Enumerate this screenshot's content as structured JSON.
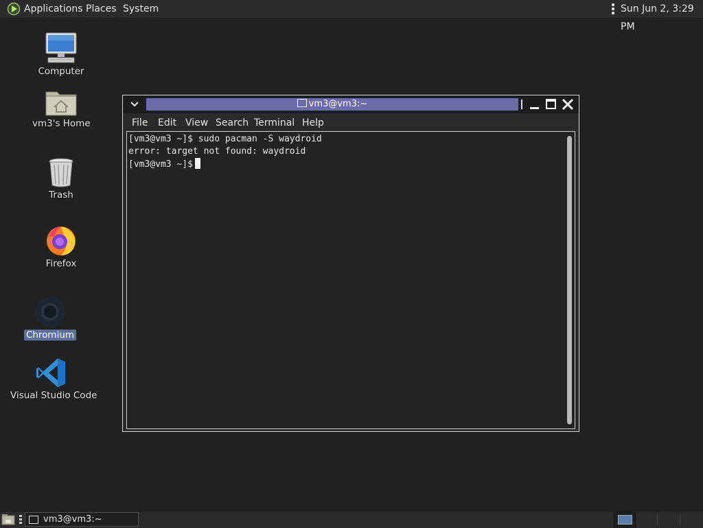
{
  "top_panel": {
    "menus": [
      "Applications",
      "Places",
      "System"
    ],
    "clock": "Sun Jun  2,  3:29 PM"
  },
  "desktop": {
    "icons": [
      {
        "label": "Computer",
        "icon": "computer-icon"
      },
      {
        "label": "vm3's Home",
        "icon": "home-folder-icon"
      },
      {
        "label": "Trash",
        "icon": "trash-icon"
      },
      {
        "label": "Firefox",
        "icon": "firefox-icon"
      },
      {
        "label": "Chromium",
        "icon": "chromium-icon",
        "selected": true
      },
      {
        "label": "Visual Studio Code",
        "icon": "vscode-icon"
      }
    ]
  },
  "terminal": {
    "title": "vm3@vm3:~",
    "menu": [
      "File",
      "Edit",
      "View",
      "Search",
      "Terminal",
      "Help"
    ],
    "lines": [
      "[vm3@vm3 ~]$ sudo pacman -S waydroid",
      "error: target not found: waydroid",
      "[vm3@vm3 ~]$"
    ]
  },
  "taskbar": {
    "task_label": "vm3@vm3:~"
  },
  "colors": {
    "desktop_bg": "#212121",
    "title_active": "#6d6aa8",
    "selection": "#5a6f9a",
    "vscode_blue": "#2f8fd8"
  }
}
